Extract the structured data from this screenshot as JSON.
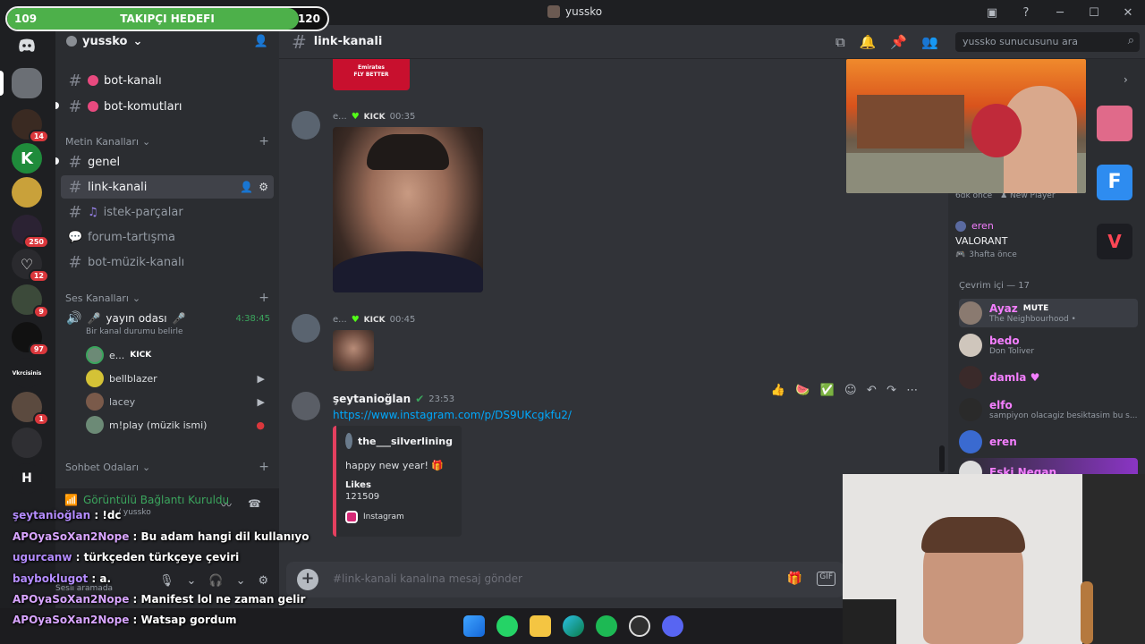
{
  "window": {
    "title": "yussko"
  },
  "follow_goal": {
    "label": "TAKIPÇI HEDEFI",
    "current": "109",
    "target": "120",
    "progress": 0.91
  },
  "server": {
    "name": "yussko",
    "rail_badges": [
      "14",
      "250",
      "12",
      "9",
      "97",
      "1"
    ],
    "rail_letter": "H",
    "rail_text": "Vkrcisinis"
  },
  "sidebar": {
    "channels_top": [
      {
        "label": "bot-kanalı"
      },
      {
        "label": "bot-komutları"
      }
    ],
    "text_category": "Metin Kanalları",
    "text_channels": [
      {
        "label": "genel"
      },
      {
        "label": "link-kanali"
      },
      {
        "label": "istek-parçalar"
      },
      {
        "label": "forum-tartışma"
      },
      {
        "label": "bot-müzik-kanalı"
      }
    ],
    "voice_category": "Ses Kanalları",
    "voice_channel": {
      "label": "yayın odası",
      "timer": "4:38:45",
      "status": "Bir kanal durumu belirle"
    },
    "voice_users": [
      {
        "name": "e...",
        "tag": "KICK"
      },
      {
        "name": "bellblazer"
      },
      {
        "name": "lacey"
      },
      {
        "name": "m!play (müzik ismi)"
      }
    ],
    "chat_category": "Sohbet Odaları",
    "voice_panel": {
      "status": "Görüntülü Bağlantı Kuruldu",
      "sub": "/ yussko",
      "user_status": "Sesli aramada"
    }
  },
  "stream_chat": [
    {
      "user": "şeytanioğlan",
      "text": " : !dc"
    },
    {
      "user": "APOyaSoXan2Nope",
      "text": " : Bu adam hangi dil kullanıyo"
    },
    {
      "user": "ugurcanw",
      "text": " : türkçeden türkçeye çeviri"
    },
    {
      "user": "bayboklugot",
      "text": " : a."
    },
    {
      "user": "APOyaSoXan2Nope",
      "text": " : Manifest lol ne zaman gelir"
    },
    {
      "user": "APOyaSoXan2Nope",
      "text": " : Watsap gordum"
    }
  ],
  "channel_header": {
    "name": "link-kanali",
    "search_placeholder": "yussko sunucusunu ara"
  },
  "messages": [
    {
      "user": "e...",
      "tag": "KICK",
      "time": "00:35"
    },
    {
      "user": "e...",
      "tag": "KICK",
      "time": "00:45"
    },
    {
      "user": "şeytanioğlan",
      "time": "23:53",
      "link": "https://www.instagram.com/p/DS9UKcgkfu2/"
    }
  ],
  "embed": {
    "author": "the___silverlining",
    "description": "happy new year! 🎁",
    "field_name": "Likes",
    "field_value": "121509",
    "footer": "Instagram"
  },
  "jersey_text": "Emirates\nFLY BETTER",
  "composer": {
    "placeholder": "#link-kanali kanalına mesaj gönder"
  },
  "members": {
    "activity_cards": [
      {
        "time": "6dk önce",
        "detail": "New Player"
      },
      {
        "user": "eren",
        "game": "VALORANT",
        "time": "3hafta önce"
      }
    ],
    "online_header": "Çevrim içi — 17",
    "list": [
      {
        "name": "Ayaz",
        "badge": "MUTE",
        "status": "The Neighbourhood •",
        "color": "#f47fff"
      },
      {
        "name": "bedo",
        "status": "Don Toliver",
        "color": "#f47fff"
      },
      {
        "name": "damla",
        "status": "",
        "color": "#f47fff"
      },
      {
        "name": "elfo",
        "status": "sampiyon olacagiz besiktasim bu s...",
        "color": "#f47fff"
      },
      {
        "name": "eren",
        "status": "",
        "color": "#f47fff"
      },
      {
        "name": "Eski Negan",
        "status": "",
        "color": "#f47fff"
      }
    ]
  },
  "colors": {
    "accent": "#5865f2",
    "kick": "#53fc18",
    "member_name": "#f47fff",
    "goal_fill": "#4db04a"
  }
}
